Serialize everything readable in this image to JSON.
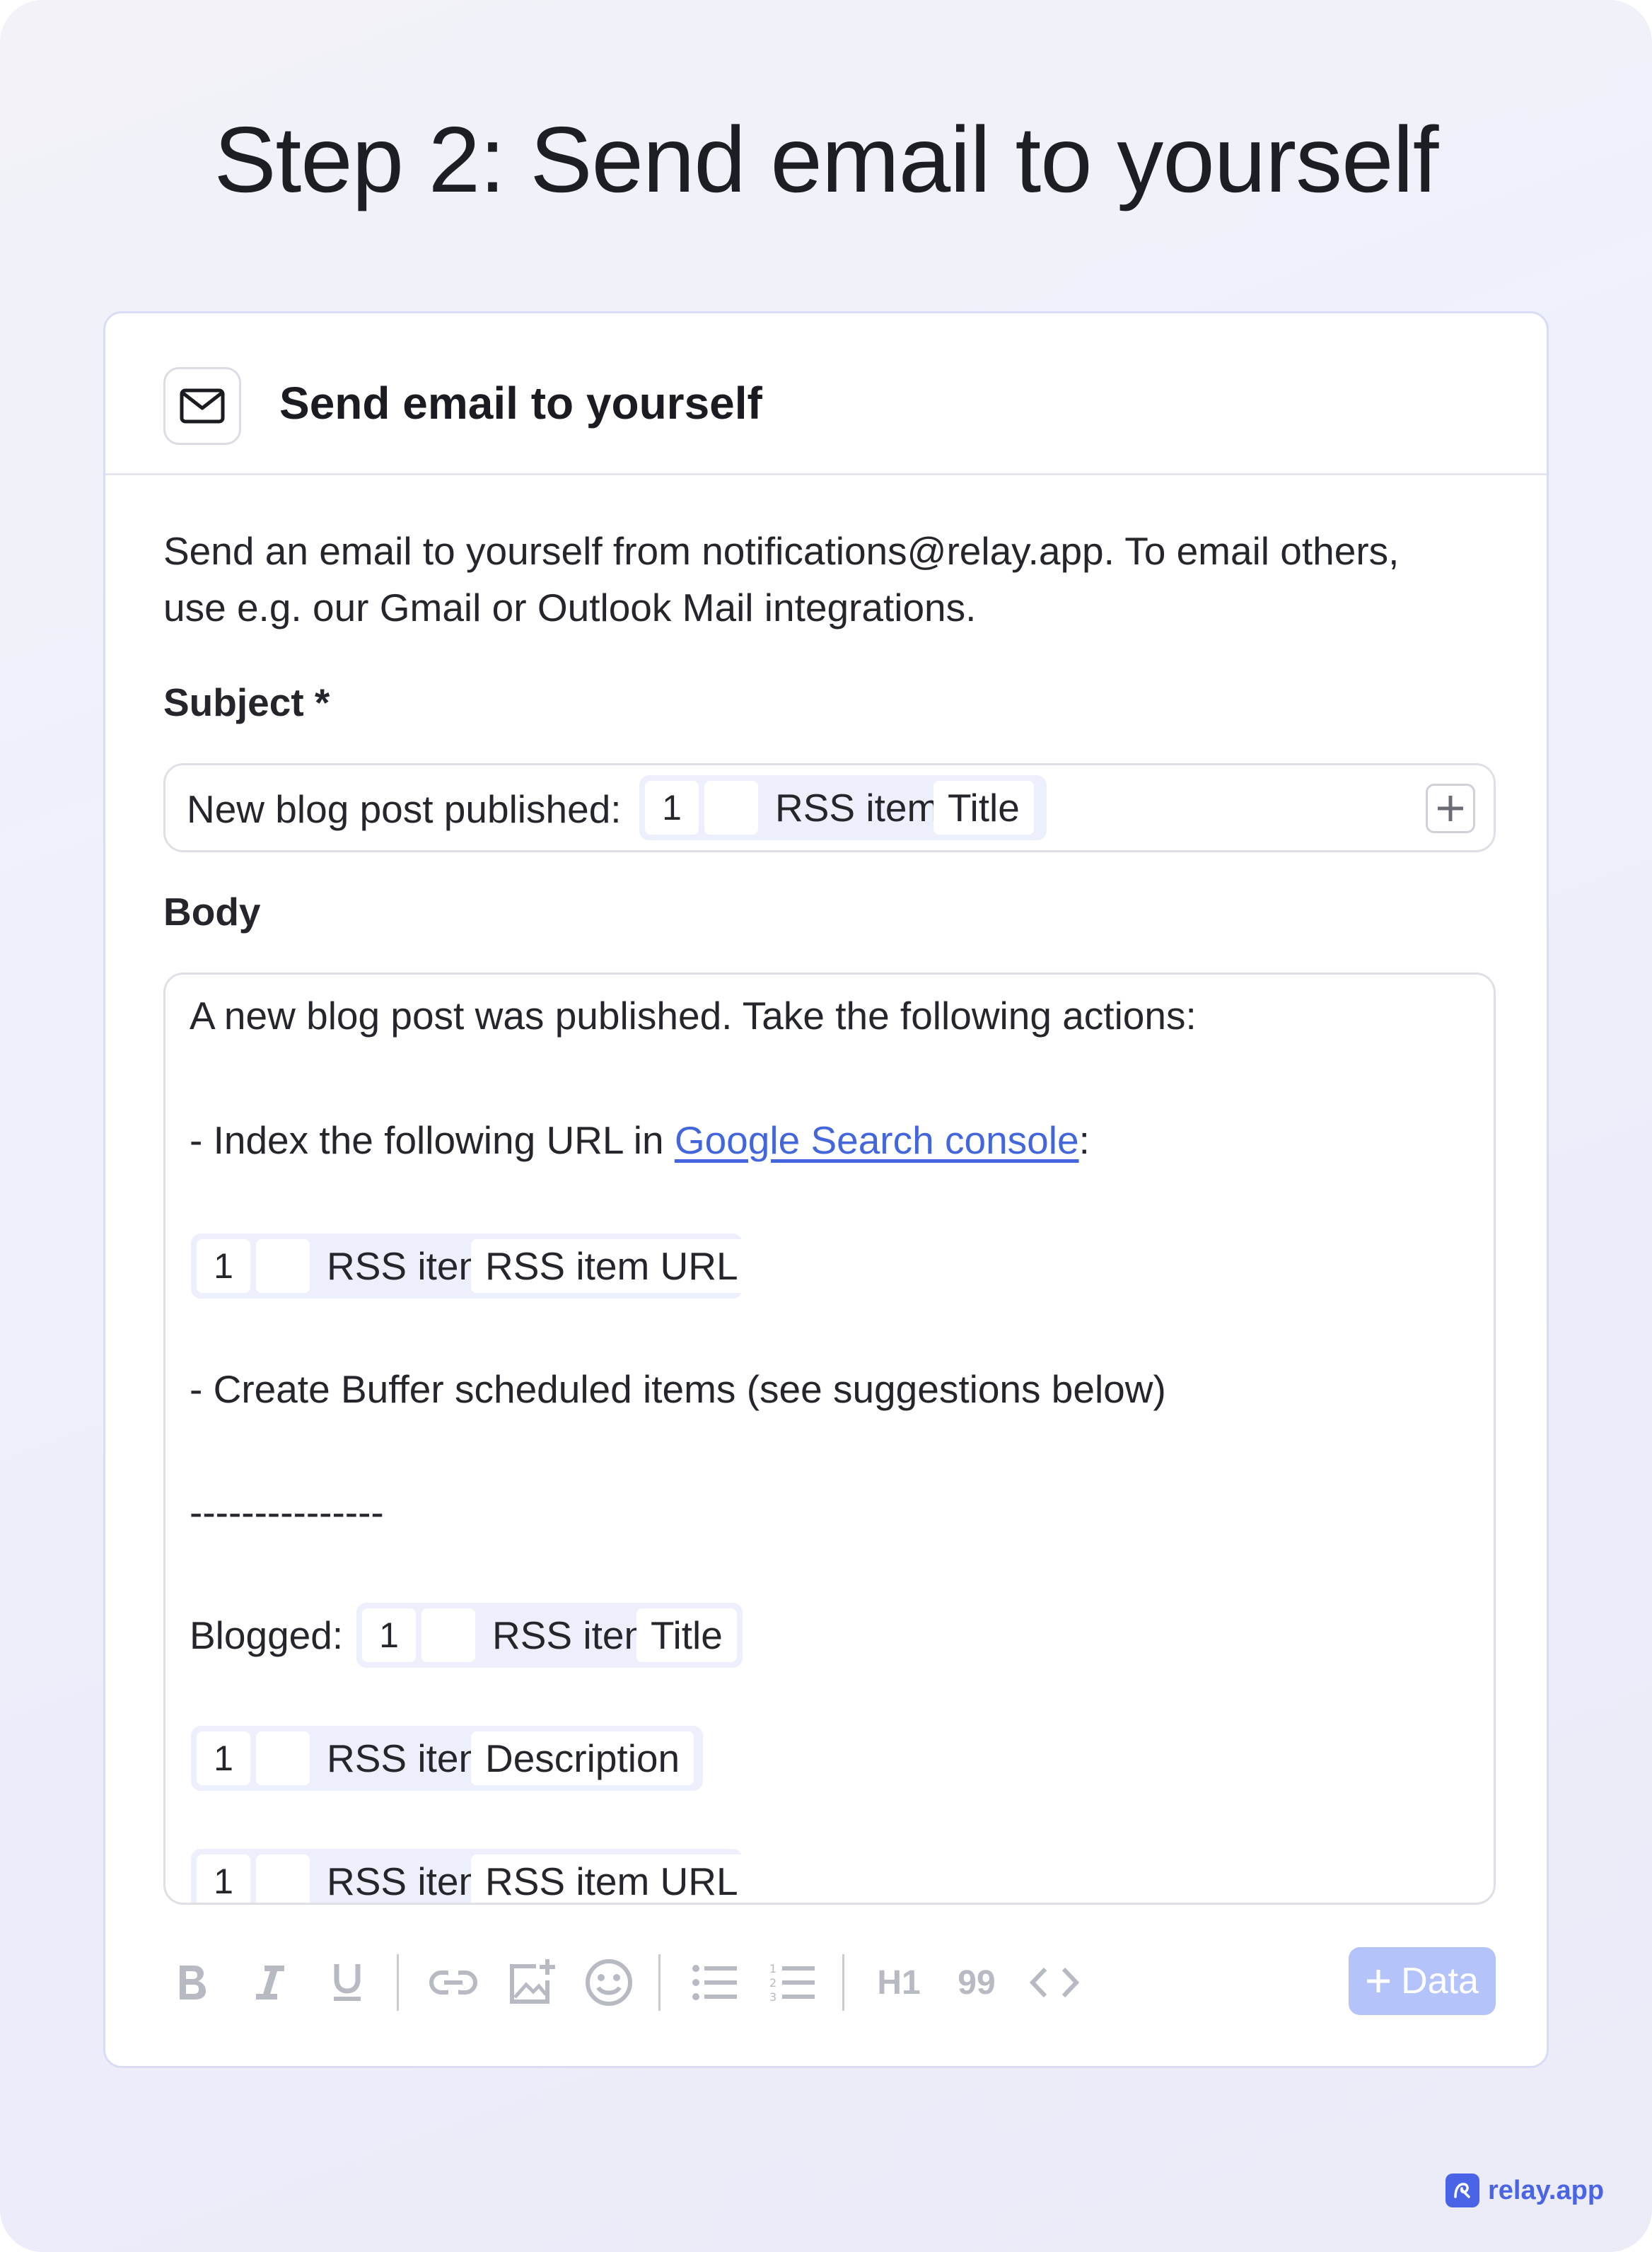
{
  "page": {
    "title": "Step 2: Send email to yourself"
  },
  "card": {
    "title": "Send email to yourself",
    "icon": "mail-icon",
    "description_line1": "Send an email to yourself from notifications@relay.app. To email others,",
    "description_line2": "use e.g. our Gmail or Outlook Mail integrations."
  },
  "subject": {
    "label": "Subject *",
    "prefix": "New blog post published:",
    "token": {
      "step": "1",
      "source": "RSS item",
      "field": "Title"
    },
    "add_icon": "plus-icon"
  },
  "body": {
    "label": "Body",
    "line1": "A new blog post was published. Take the following actions:",
    "line2_prefix": "- Index the following URL in ",
    "line2_link": "Google Search console",
    "line2_suffix": ":",
    "token_url": {
      "step": "1",
      "source": "RSS item",
      "field": "RSS item URL"
    },
    "line3": "- Create Buffer scheduled items (see suggestions below)",
    "divider": "---------------",
    "blogged_label": "Blogged:",
    "token_title": {
      "step": "1",
      "source": "RSS item",
      "field": "Title"
    },
    "token_desc": {
      "step": "1",
      "source": "RSS item",
      "field": "Description"
    },
    "token_url2": {
      "step": "1",
      "source": "RSS item",
      "field": "RSS item URL"
    }
  },
  "toolbar": {
    "bold_icon": "bold-icon",
    "italic_icon": "italic-icon",
    "underline_icon": "underline-icon",
    "link_icon": "link-icon",
    "image_icon": "add-image-icon",
    "emoji_icon": "emoji-icon",
    "bullet_icon": "bullet-list-icon",
    "numbered_icon": "numbered-list-icon",
    "h1_label": "H1",
    "quote_label": "99",
    "code_icon": "code-icon",
    "data_button": "Data"
  },
  "brand": {
    "name": "relay.app"
  },
  "colors": {
    "accent": "#4a64e8",
    "link": "#4466dd",
    "chip_bg": "#edf0fc",
    "data_button": "#b5c3fb"
  }
}
